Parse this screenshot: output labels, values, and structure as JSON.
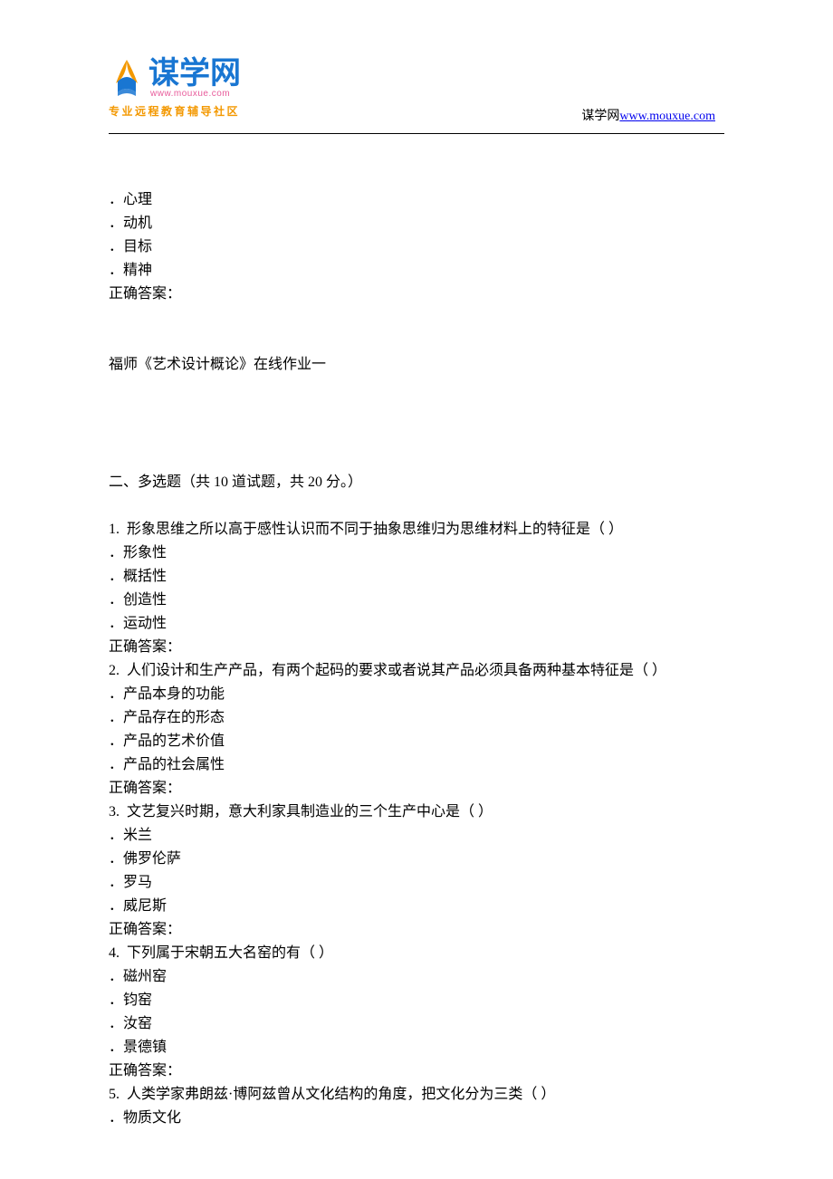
{
  "logo": {
    "brand_text": "谋学网",
    "brand_url": "www.mouxue.com",
    "tagline": "专业远程教育辅导社区"
  },
  "header": {
    "label": "谋学网",
    "link_text": "www.mouxue.com"
  },
  "intro": {
    "options": [
      "．心理",
      "．动机",
      "．目标",
      "．精神"
    ],
    "answer_label": "正确答案："
  },
  "course_title": "福师《艺术设计概论》在线作业一",
  "section": {
    "title": "二、多选题（共 10 道试题，共 20 分。）"
  },
  "questions": [
    {
      "num": "1.",
      "text": "  形象思维之所以高于感性认识而不同于抽象思维归为思维材料上的特征是（ ）",
      "options": [
        "．形象性",
        "．概括性",
        "．创造性",
        "．运动性"
      ],
      "answer_label": "正确答案："
    },
    {
      "num": "2.",
      "text": "  人们设计和生产产品，有两个起码的要求或者说其产品必须具备两种基本特征是（ ）",
      "options": [
        "．产品本身的功能",
        "．产品存在的形态",
        "．产品的艺术价值",
        "．产品的社会属性"
      ],
      "answer_label": "正确答案："
    },
    {
      "num": "3.",
      "text": "  文艺复兴时期，意大利家具制造业的三个生产中心是（ ）",
      "options": [
        "．米兰",
        "．佛罗伦萨",
        "．罗马",
        "．威尼斯"
      ],
      "answer_label": "正确答案："
    },
    {
      "num": "4.",
      "text": "  下列属于宋朝五大名窑的有（ ）",
      "options": [
        "．磁州窑",
        "．钧窑",
        "．汝窑",
        "．景德镇"
      ],
      "answer_label": "正确答案："
    },
    {
      "num": "5.",
      "text": "  人类学家弗朗兹·博阿兹曾从文化结构的角度，把文化分为三类（ ）",
      "options": [
        "．物质文化"
      ],
      "answer_label": ""
    }
  ]
}
